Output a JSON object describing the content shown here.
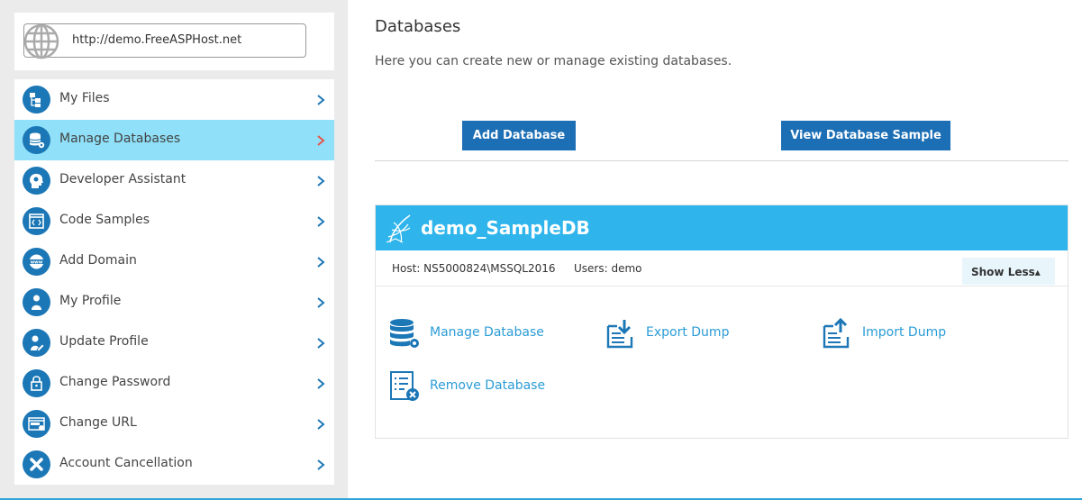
{
  "sidebar": {
    "url": "http://demo.FreeASPHost.net",
    "items": [
      {
        "label": "My Files",
        "icon": "files-icon"
      },
      {
        "label": "Manage Databases",
        "icon": "database-icon"
      },
      {
        "label": "Developer Assistant",
        "icon": "developer-head-icon"
      },
      {
        "label": "Code Samples",
        "icon": "code-icon"
      },
      {
        "label": "Add Domain",
        "icon": "www-icon"
      },
      {
        "label": "My Profile",
        "icon": "user-icon"
      },
      {
        "label": "Update Profile",
        "icon": "user-edit-icon"
      },
      {
        "label": "Change Password",
        "icon": "lock-icon"
      },
      {
        "label": "Change URL",
        "icon": "url-window-icon"
      },
      {
        "label": "Account Cancellation",
        "icon": "cancel-icon"
      }
    ],
    "active_index": 1
  },
  "main": {
    "title": "Databases",
    "subtitle": "Here you can create new or manage existing databases.",
    "add_button": "Add Database",
    "view_sample_button": "View Database Sample",
    "database": {
      "name": "demo_SampleDB",
      "host": "Host: NS5000824\\MSSQL2016",
      "users": "Users: demo",
      "show_less": "Show Less▴",
      "actions": {
        "manage": "Manage Database",
        "export": "Export Dump",
        "import": "Import Dump",
        "remove": "Remove Database"
      }
    }
  },
  "colors": {
    "accent": "#1d6fb5",
    "active_item": "#8fe0f8",
    "db_header": "#2fb5ec",
    "link": "#2b9cd6",
    "active_chevron": "#e8544a",
    "chevron": "#1c77b6"
  }
}
